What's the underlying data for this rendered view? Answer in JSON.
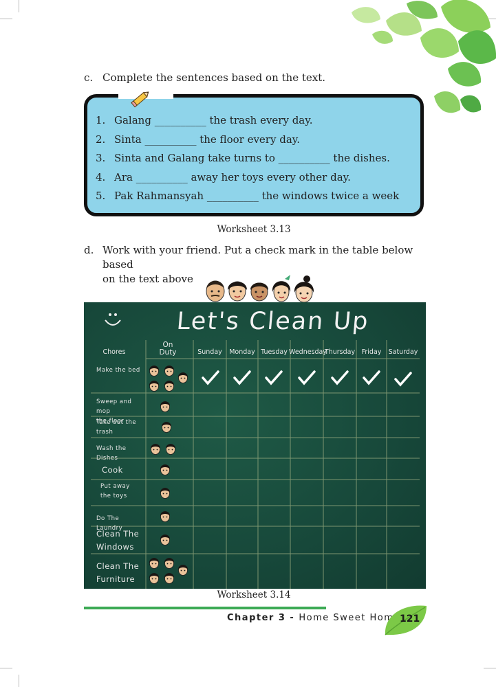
{
  "section_c": {
    "letter": "c.",
    "instruction": "Complete the sentences based on the text.",
    "items": [
      {
        "num": "1.",
        "text": "Galang __________ the trash every day."
      },
      {
        "num": "2.",
        "text": "Sinta __________ the floor every day."
      },
      {
        "num": "3.",
        "text": "Sinta and Galang take turns to __________ the dishes."
      },
      {
        "num": "4.",
        "text": "Ara __________ away her toys every other day."
      },
      {
        "num": "5.",
        "text": "Pak Rahmansyah __________ the windows twice a week"
      }
    ],
    "caption": "Worksheet 3.13"
  },
  "section_d": {
    "letter": "d.",
    "instruction_line1": "Work with your friend. Put a check mark in the table below based",
    "instruction_line2": "on the text above"
  },
  "board": {
    "title": "Let's Clean Up",
    "col_chores": "Chores",
    "col_duty_1": "On",
    "col_duty_2": "Duty",
    "days": [
      "Sunday",
      "Monday",
      "Tuesday",
      "Wednesday",
      "Thursday",
      "Friday",
      "Saturday"
    ],
    "chores": [
      {
        "line1": "Make the bed",
        "line2": ""
      },
      {
        "line1": "Sweep and mop",
        "line2": "the floor"
      },
      {
        "line1": "Take out the",
        "line2": "trash"
      },
      {
        "line1": "Wash the Dishes",
        "line2": ""
      },
      {
        "line1": "Cook",
        "line2": ""
      },
      {
        "line1": "Put away",
        "line2": "the toys"
      },
      {
        "line1": "Do The Laundry",
        "line2": ""
      },
      {
        "line1": "Clean The",
        "line2": "Windows"
      },
      {
        "line1": "Clean The",
        "line2": "Furniture"
      }
    ],
    "checked_row": "Make the bed",
    "caption": "Worksheet 3.14"
  },
  "footer": {
    "chapter": "Chapter 3 - ",
    "title": "Home Sweet Home",
    "page": "121"
  },
  "colors": {
    "accent_green": "#3caa55",
    "box_blue": "#8fd4ea",
    "board_green": "#17483a"
  }
}
